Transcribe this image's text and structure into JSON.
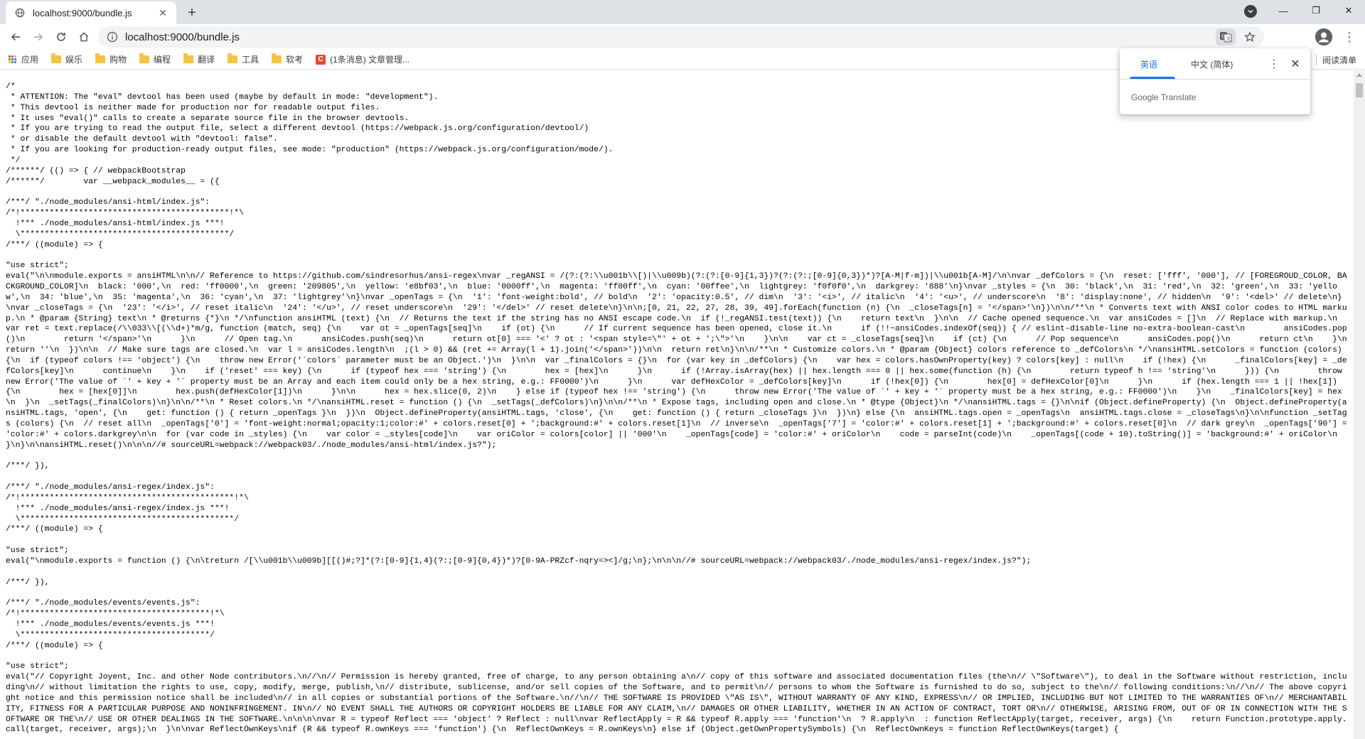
{
  "tab": {
    "title": "localhost:9000/bundle.js",
    "close_glyph": "✕",
    "favicon": "globe-icon"
  },
  "new_tab_glyph": "+",
  "window_controls": {
    "minimize": "—",
    "maximize": "❐",
    "close": "✕"
  },
  "toolbar": {
    "url": "localhost:9000/bundle.js",
    "menu_glyph": "⋮"
  },
  "bookmarks": {
    "items": [
      {
        "label": "应用",
        "icon": "apps-grid-icon"
      },
      {
        "label": "娱乐",
        "icon": "folder-icon"
      },
      {
        "label": "购物",
        "icon": "folder-icon"
      },
      {
        "label": "编程",
        "icon": "folder-icon"
      },
      {
        "label": "翻译",
        "icon": "folder-icon"
      },
      {
        "label": "工具",
        "icon": "folder-icon"
      },
      {
        "label": "软考",
        "icon": "folder-icon"
      },
      {
        "label": "(1条消息) 文章管理...",
        "icon": "csdn-icon"
      }
    ],
    "reading_list": "阅读清单",
    "csdn_letter": "C"
  },
  "translate": {
    "tabs": [
      "英语",
      "中文 (简体)"
    ],
    "active_tab": 0,
    "kebab": "⋮",
    "close": "✕",
    "brand": "Google Translate"
  },
  "colors": {
    "accent": "#1a73e8",
    "folder": "#f6c344",
    "csdn": "#e84a2f"
  },
  "code": "/*\n * ATTENTION: The \"eval\" devtool has been used (maybe by default in mode: \"development\").\n * This devtool is neither made for production nor for readable output files.\n * It uses \"eval()\" calls to create a separate source file in the browser devtools.\n * If you are trying to read the output file, select a different devtool (https://webpack.js.org/configuration/devtool/)\n * or disable the default devtool with \"devtool: false\".\n * If you are looking for production-ready output files, see mode: \"production\" (https://webpack.js.org/configuration/mode/).\n */\n/******/ (() => { // webpackBootstrap\n/******/ \tvar __webpack_modules__ = ({\n\n/***/ \"./node_modules/ansi-html/index.js\":\n/*!*******************************************!*\\\n  !*** ./node_modules/ansi-html/index.js ***!\n  \\*******************************************/\n/***/ ((module) => {\n\n\"use strict\";\neval(\"\\n\\nmodule.exports = ansiHTML\\n\\n// Reference to https://github.com/sindresorhus/ansi-regex\\nvar _regANSI = /(?:(?:\\\\u001b\\\\[)|\\\\u009b)(?:(?:[0-9]{1,3})?(?:(?:;[0-9]{0,3})*)?[A-M|f-m])|\\\\u001b[A-M]/\\n\\nvar _defColors = {\\n  reset: ['fff', '000'], // [FOREGROUD_COLOR, BACKGROUND_COLOR]\\n  black: '000',\\n  red: 'ff0000',\\n  green: '209805',\\n  yellow: 'e8bf03',\\n  blue: '0000ff',\\n  magenta: 'ff00ff',\\n  cyan: '00ffee',\\n  lightgrey: 'f0f0f0',\\n  darkgrey: '888'\\n}\\nvar _styles = {\\n  30: 'black',\\n  31: 'red',\\n  32: 'green',\\n  33: 'yellow',\\n  34: 'blue',\\n  35: 'magenta',\\n  36: 'cyan',\\n  37: 'lightgrey'\\n}\\nvar _openTags = {\\n  '1': 'font-weight:bold', // bold\\n  '2': 'opacity:0.5', // dim\\n  '3': '<i>', // italic\\n  '4': '<u>', // underscore\\n  '8': 'display:none', // hidden\\n  '9': '<del>' // delete\\n}\\nvar _closeTags = {\\n  '23': '</i>', // reset italic\\n  '24': '</u>', // reset underscore\\n  '29': '</del>' // reset delete\\n}\\n\\n;[0, 21, 22, 27, 28, 39, 49].forEach(function (n) {\\n  _closeTags[n] = '</span>'\\n})\\n\\n/**\\n * Converts text with ANSI color codes to HTML markup.\\n * @param {String} text\\n * @returns {*}\\n */\\nfunction ansiHTML (text) {\\n  // Returns the text if the string has no ANSI escape code.\\n  if (!_regANSI.test(text)) {\\n    return text\\n  }\\n\\n  // Cache opened sequence.\\n  var ansiCodes = []\\n  // Replace with markup.\\n  var ret = text.replace(/\\\\033\\\\[(\\\\d+)*m/g, function (match, seq) {\\n    var ot = _openTags[seq]\\n    if (ot) {\\n      // If current sequence has been opened, close it.\\n      if (!!~ansiCodes.indexOf(seq)) { // eslint-disable-line no-extra-boolean-cast\\n        ansiCodes.pop()\\n        return '</span>'\\n      }\\n      // Open tag.\\n      ansiCodes.push(seq)\\n      return ot[0] === '<' ? ot : '<span style=\\\"' + ot + ';\\\">'\\n    }\\n\\n    var ct = _closeTags[seq]\\n    if (ct) {\\n      // Pop sequence\\n      ansiCodes.pop()\\n      return ct\\n    }\\n    return ''\\n  })\\n\\n  // Make sure tags are closed.\\n  var l = ansiCodes.length\\n  ;(l > 0) && (ret += Array(l + 1).join('</span>'))\\n\\n  return ret\\n}\\n\\n/**\\n * Customize colors.\\n * @param {Object} colors reference to _defColors\\n */\\nansiHTML.setColors = function (colors) {\\n  if (typeof colors !== 'object') {\\n    throw new Error('`colors` parameter must be an Object.')\\n  }\\n\\n  var _finalColors = {}\\n  for (var key in _defColors) {\\n    var hex = colors.hasOwnProperty(key) ? colors[key] : null\\n    if (!hex) {\\n      _finalColors[key] = _defColors[key]\\n      continue\\n    }\\n    if ('reset' === key) {\\n      if (typeof hex === 'string') {\\n        hex = [hex]\\n      }\\n      if (!Array.isArray(hex) || hex.length === 0 || hex.some(function (h) {\\n        return typeof h !== 'string'\\n      })) {\\n        throw new Error('The value of `' + key + '` property must be an Array and each item could only be a hex string, e.g.: FF0000')\\n      }\\n      var defHexColor = _defColors[key]\\n      if (!hex[0]) {\\n        hex[0] = defHexColor[0]\\n      }\\n      if (hex.length === 1 || !hex[1]) {\\n        hex = [hex[0]]\\n        hex.push(defHexColor[1])\\n      }\\n\\n      hex = hex.slice(0, 2)\\n    } else if (typeof hex !== 'string') {\\n      throw new Error('The value of `' + key + '` property must be a hex string, e.g.: FF0000')\\n    }\\n    _finalColors[key] = hex\\n  }\\n  _setTags(_finalColors)\\n}\\n\\n/**\\n * Reset colors.\\n */\\nansiHTML.reset = function () {\\n  _setTags(_defColors)\\n}\\n\\n/**\\n * Expose tags, including open and close.\\n * @type {Object}\\n */\\nansiHTML.tags = {}\\n\\nif (Object.defineProperty) {\\n  Object.defineProperty(ansiHTML.tags, 'open', {\\n    get: function () { return _openTags }\\n  })\\n  Object.defineProperty(ansiHTML.tags, 'close', {\\n    get: function () { return _closeTags }\\n  })\\n} else {\\n  ansiHTML.tags.open = _openTags\\n  ansiHTML.tags.close = _closeTags\\n}\\n\\nfunction _setTags (colors) {\\n  // reset all\\n  _openTags['0'] = 'font-weight:normal;opacity:1;color:#' + colors.reset[0] + ';background:#' + colors.reset[1]\\n  // inverse\\n  _openTags['7'] = 'color:#' + colors.reset[1] + ';background:#' + colors.reset[0]\\n  // dark grey\\n  _openTags['90'] = 'color:#' + colors.darkgrey\\n\\n  for (var code in _styles) {\\n    var color = _styles[code]\\n    var oriColor = colors[color] || '000'\\n    _openTags[code] = 'color:#' + oriColor\\n    code = parseInt(code)\\n    _openTags[(code + 10).toString()] = 'background:#' + oriColor\\n  }\\n}\\n\\nansiHTML.reset()\\n\\n\\n//# sourceURL=webpack://webpack03/./node_modules/ansi-html/index.js?\");\n\n/***/ }),\n\n/***/ \"./node_modules/ansi-regex/index.js\":\n/*!********************************************!*\\\n  !*** ./node_modules/ansi-regex/index.js ***!\n  \\********************************************/\n/***/ ((module) => {\n\n\"use strict\";\neval(\"\\nmodule.exports = function () {\\n\\treturn /[\\\\u001b\\\\u009b][[()#;?]*(?:[0-9]{1,4}(?:;[0-9]{0,4})*)?[0-9A-PRZcf-nqry=><]/g;\\n};\\n\\n\\n//# sourceURL=webpack://webpack03/./node_modules/ansi-regex/index.js?\");\n\n/***/ }),\n\n/***/ \"./node_modules/events/events.js\":\n/*!***************************************!*\\\n  !*** ./node_modules/events/events.js ***!\n  \\***************************************/\n/***/ ((module) => {\n\n\"use strict\";\neval(\"// Copyright Joyent, Inc. and other Node contributors.\\n//\\n// Permission is hereby granted, free of charge, to any person obtaining a\\n// copy of this software and associated documentation files (the\\n// \\\"Software\\\"), to deal in the Software without restriction, including\\n// without limitation the rights to use, copy, modify, merge, publish,\\n// distribute, sublicense, and/or sell copies of the Software, and to permit\\n// persons to whom the Software is furnished to do so, subject to the\\n// following conditions:\\n//\\n// The above copyright notice and this permission notice shall be included\\n// in all copies or substantial portions of the Software.\\n//\\n// THE SOFTWARE IS PROVIDED \\\"AS IS\\\", WITHOUT WARRANTY OF ANY KIND, EXPRESS\\n// OR IMPLIED, INCLUDING BUT NOT LIMITED TO THE WARRANTIES OF\\n// MERCHANTABILITY, FITNESS FOR A PARTICULAR PURPOSE AND NONINFRINGEMENT. IN\\n// NO EVENT SHALL THE AUTHORS OR COPYRIGHT HOLDERS BE LIABLE FOR ANY CLAIM,\\n// DAMAGES OR OTHER LIABILITY, WHETHER IN AN ACTION OF CONTRACT, TORT OR\\n// OTHERWISE, ARISING FROM, OUT OF OR IN CONNECTION WITH THE SOFTWARE OR THE\\n// USE OR OTHER DEALINGS IN THE SOFTWARE.\\n\\n\\n\\nvar R = typeof Reflect === 'object' ? Reflect : null\\nvar ReflectApply = R && typeof R.apply === 'function'\\n  ? R.apply\\n  : function ReflectApply(target, receiver, args) {\\n    return Function.prototype.apply.call(target, receiver, args);\\n  }\\n\\nvar ReflectOwnKeys\\nif (R && typeof R.ownKeys === 'function') {\\n  ReflectOwnKeys = R.ownKeys\\n} else if (Object.getOwnPropertySymbols) {\\n  ReflectOwnKeys = function ReflectOwnKeys(target) {"
}
